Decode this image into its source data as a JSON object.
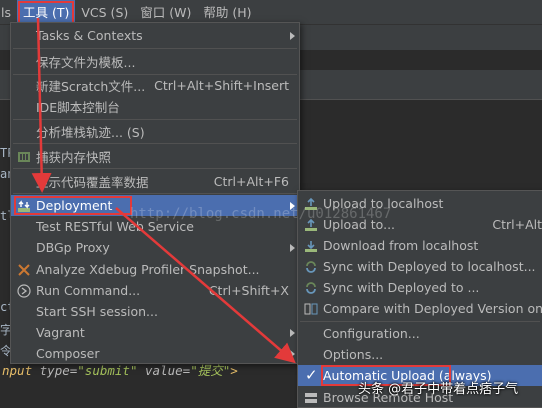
{
  "menubar": {
    "items": [
      {
        "label": "ls"
      },
      {
        "label": "工具 (T)"
      },
      {
        "label": "VCS (S)"
      },
      {
        "label": "窗口 (W)"
      },
      {
        "label": "帮助 (H)"
      }
    ]
  },
  "main_menu": {
    "items": [
      {
        "label": "Tasks & Contexts"
      },
      {
        "label": "保存文件为模板..."
      },
      {
        "label": "新建Scratch文件...",
        "shortcut": "Ctrl+Alt+Shift+Insert"
      },
      {
        "label": "IDE脚本控制台"
      },
      {
        "label": "分析堆栈轨迹... (S)"
      },
      {
        "label": "捕获内存快照"
      },
      {
        "label": "显示代码覆盖率数据",
        "shortcut": "Ctrl+Alt+F6"
      },
      {
        "label": "Deployment"
      },
      {
        "label": "Test RESTful Web Service"
      },
      {
        "label": "DBGp Proxy"
      },
      {
        "label": "Analyze Xdebug Profiler Snapshot..."
      },
      {
        "label": "Run Command...",
        "shortcut": "Ctrl+Shift+X"
      },
      {
        "label": "Start SSH session..."
      },
      {
        "label": "Vagrant"
      },
      {
        "label": "Composer"
      }
    ]
  },
  "deployment_menu": {
    "items": [
      {
        "label": "Upload to localhost"
      },
      {
        "label": "Upload to...",
        "shortcut": "Ctrl+Alt"
      },
      {
        "label": "Download from localhost"
      },
      {
        "label": "Sync with Deployed to localhost..."
      },
      {
        "label": "Sync with Deployed to ..."
      },
      {
        "label": "Compare with Deployed Version on lo"
      },
      {
        "label": "Configuration..."
      },
      {
        "label": "Options..."
      },
      {
        "label": "Automatic Upload (always)"
      },
      {
        "label": "Browse Remote Host"
      }
    ]
  },
  "editor": {
    "frag_1": "TP",
    "frag_2": "an",
    "frag_3": "tl",
    "frag_4": "ct",
    "frag_5": "字",
    "frag_6": "令",
    "bottom_tag": "nput ",
    "bottom_attr_1": "type=",
    "bottom_val_1": "\"submit\"",
    "bottom_attr_2": " value=",
    "bottom_val_2": "\"提交\"",
    "bottom_end": ">"
  },
  "watermark": "http://blog.csdn.net/u012861467",
  "toutiao": "头条 @君子中带着点痞子气",
  "colors": {
    "menu_bg": "#3c3f41",
    "selection": "#4b6eaf",
    "highlight_border": "#e33a3a",
    "editor_bg": "#2b2b2b",
    "text": "#bbbbbb"
  }
}
